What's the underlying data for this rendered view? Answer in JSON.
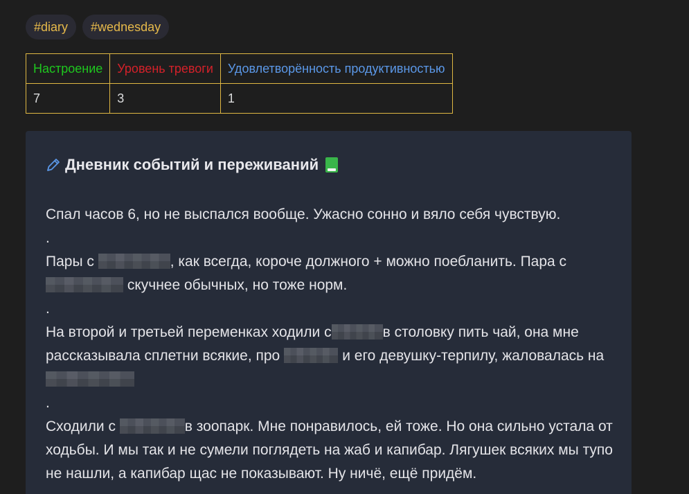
{
  "tags": [
    "#diary",
    "#wednesday"
  ],
  "table": {
    "headers": [
      "Настроение",
      "Уровень тревоги",
      "Удовлетворённость продуктивностью"
    ],
    "values": [
      "7",
      "3",
      "1"
    ],
    "header_colors": [
      "#1ec81e",
      "#d4212a",
      "#5b98e8"
    ]
  },
  "card": {
    "icon": "pencil-icon",
    "title": "Дневник событий и переживаний",
    "title_icon": "green-book-icon",
    "paragraphs": {
      "p1": "Спал часов 6, но не выспался вообще. Ужасно сонно и вяло себя чувствую.",
      "dot": ".",
      "p2a": "Пары с",
      "p2b": ", как всегда, короче должного + можно поебланить. Пара с",
      "p2c": "скучнее обычных, но тоже норм.",
      "p3a": "На второй и третьей переменках ходили с",
      "p3b": "в столовку пить чай, она мне рассказывала сплетни всякие, про",
      "p3c": "и его девушку-терпилу, жаловалась на",
      "p4a": "Сходили с",
      "p4b": "в зоопарк. Мне понравилось, ей тоже. Но она сильно устала от ходьбы. И мы так и не сумели поглядеть на жаб и капибар. Лягушек всяких мы тупо не нашли, а капибар щас не показывают. Ну ничё, ещё придём."
    }
  },
  "colors": {
    "background": "#1e1e1e",
    "card_background": "#262c39",
    "tag_text": "#e6b94a",
    "table_border": "#e0b843"
  }
}
